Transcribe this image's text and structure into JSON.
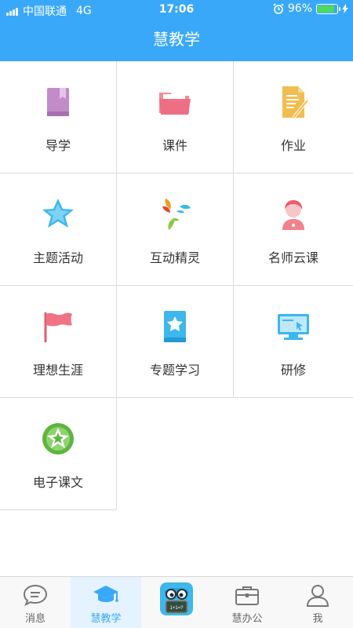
{
  "status_bar": {
    "carrier": "中国联通",
    "network": "4G",
    "time": "17:06",
    "battery": "96%",
    "battery_level": 0.96,
    "battery_color": "#4cd964"
  },
  "header": {
    "title": "慧教学",
    "color": "#3aa8f8"
  },
  "menu": [
    {
      "label": "导学",
      "icon": "book-icon"
    },
    {
      "label": "课件",
      "icon": "folder-icon"
    },
    {
      "label": "作业",
      "icon": "homework-icon"
    },
    {
      "label": "主题活动",
      "icon": "star-icon"
    },
    {
      "label": "互动精灵",
      "icon": "sprite-icon"
    },
    {
      "label": "名师云课",
      "icon": "teacher-icon"
    },
    {
      "label": "理想生涯",
      "icon": "flag-icon"
    },
    {
      "label": "专题学习",
      "icon": "star-book-icon"
    },
    {
      "label": "研修",
      "icon": "monitor-icon"
    },
    {
      "label": "电子课文",
      "icon": "star-badge-icon"
    }
  ],
  "tabbar": {
    "items": [
      {
        "label": "消息",
        "icon": "chat-icon",
        "active": false
      },
      {
        "label": "慧教学",
        "icon": "graduation-cap-icon",
        "active": true
      },
      {
        "label": "",
        "icon": "mascot-icon",
        "active": false,
        "mascot_text": "1+1=?"
      },
      {
        "label": "慧办公",
        "icon": "briefcase-icon",
        "active": false
      },
      {
        "label": "我",
        "icon": "person-icon",
        "active": false
      }
    ],
    "active_color": "#3aa8f8"
  }
}
